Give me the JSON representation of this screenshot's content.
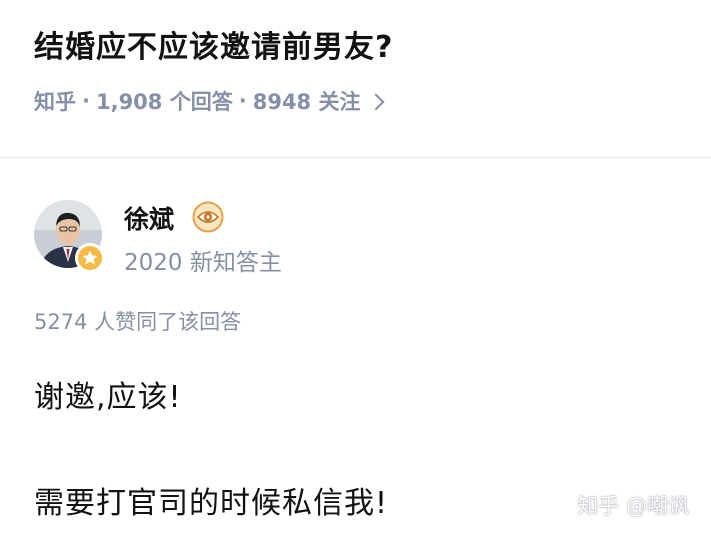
{
  "question": {
    "title": "结婚应不应该邀请前男友?",
    "source": "知乎",
    "answer_count": "1,908 个回答",
    "follow_count": "8948 关注",
    "separator": "·"
  },
  "answer": {
    "author": {
      "name": "徐斌",
      "headline": "2020 新知答主",
      "badge_icon": "eye-badge-icon",
      "avatar_badge_icon": "star-badge-icon"
    },
    "upvote_text": "5274 人赞同了该回答",
    "content": [
      "谢邀,应该!",
      "需要打官司的时候私信我!"
    ]
  },
  "watermark": "知乎 @嘲讽",
  "colors": {
    "text": "#121212",
    "meta": "#8590a6",
    "divider": "#ebebeb",
    "badge_gold": "#f5b945",
    "badge_blue": "#4a90d9"
  }
}
